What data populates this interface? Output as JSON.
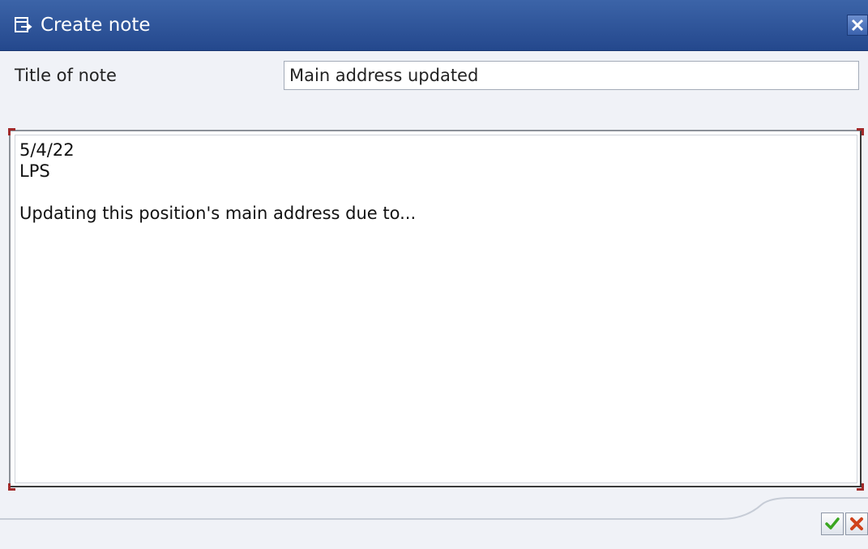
{
  "window": {
    "title": "Create note",
    "title_icon": "note-edit-icon",
    "close_icon": "close-icon"
  },
  "form": {
    "title_label": "Title of note",
    "title_value": "Main address updated"
  },
  "note": {
    "lines": [
      "5/4/22",
      "LPS",
      "",
      "Updating this position's main address due to..."
    ]
  },
  "footer": {
    "confirm_icon": "checkmark-icon",
    "cancel_icon": "cancel-icon"
  },
  "colors": {
    "titlebar": "#2c4f95",
    "confirm": "#3aa620",
    "cancel": "#d0421b"
  }
}
